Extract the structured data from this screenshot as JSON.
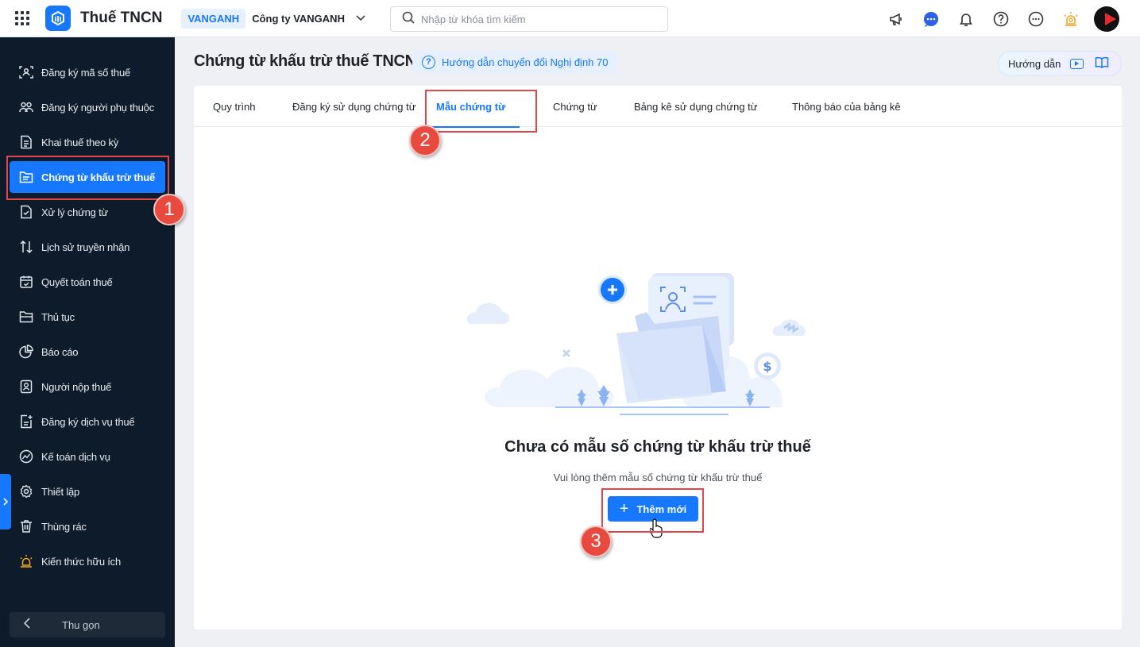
{
  "app": {
    "title": "Thuế TNCN"
  },
  "company": {
    "code": "VANGANH",
    "name": "Công ty VANGANH"
  },
  "search": {
    "placeholder": "Nhập từ khóa tìm kiếm"
  },
  "sidebar": {
    "items": [
      {
        "label": "Đăng ký mã số thuế",
        "icon": "scan-user-icon"
      },
      {
        "label": "Đăng ký người phụ thuộc",
        "icon": "people-icon"
      },
      {
        "label": "Khai thuế theo kỳ",
        "icon": "document-icon"
      },
      {
        "label": "Chứng từ khấu trừ thuế",
        "icon": "folder-doc-icon",
        "active": true
      },
      {
        "label": "Xử lý chứng từ",
        "icon": "doc-check-icon"
      },
      {
        "label": "Lịch sử truyền nhận",
        "icon": "transfer-icon"
      },
      {
        "label": "Quyết toán thuế",
        "icon": "calendar-check-icon"
      },
      {
        "label": "Thủ tục",
        "icon": "folder-icon"
      },
      {
        "label": "Báo cáo",
        "icon": "pie-chart-icon"
      },
      {
        "label": "Người nộp thuế",
        "icon": "user-card-icon"
      },
      {
        "label": "Đăng ký dịch vụ thuế",
        "icon": "doc-plus-icon"
      },
      {
        "label": "Kế toán dịch vụ",
        "icon": "chart-circle-icon"
      },
      {
        "label": "Thiết lập",
        "icon": "gear-icon"
      },
      {
        "label": "Thùng rác",
        "icon": "trash-icon"
      },
      {
        "label": "Kiến thức hữu ích",
        "icon": "bulb-icon"
      }
    ],
    "collapse_label": "Thu gọn"
  },
  "page": {
    "title": "Chứng từ khấu trừ thuế TNCN",
    "guide_link": "Hướng dẫn chuyển đổi Nghị định 70",
    "help_label": "Hướng dẫn"
  },
  "tabs": [
    {
      "label": "Quy trình"
    },
    {
      "label": "Đăng ký sử dụng chứng từ"
    },
    {
      "label": "Mẫu chứng từ",
      "active": true
    },
    {
      "label": "Chứng từ"
    },
    {
      "label": "Bảng kê sử dụng chứng từ"
    },
    {
      "label": "Thông báo của bảng kê"
    }
  ],
  "empty_state": {
    "title": "Chưa có mẫu số chứng từ khấu trừ thuế",
    "subtitle": "Vui lòng thêm mẫu số chứng từ khấu trừ thuế",
    "button_label": "Thêm mới"
  },
  "annotations": [
    "1",
    "2",
    "3"
  ],
  "colors": {
    "primary": "#1677ff",
    "sidebar_bg": "#0d1b2a",
    "highlight": "#e0474c"
  }
}
